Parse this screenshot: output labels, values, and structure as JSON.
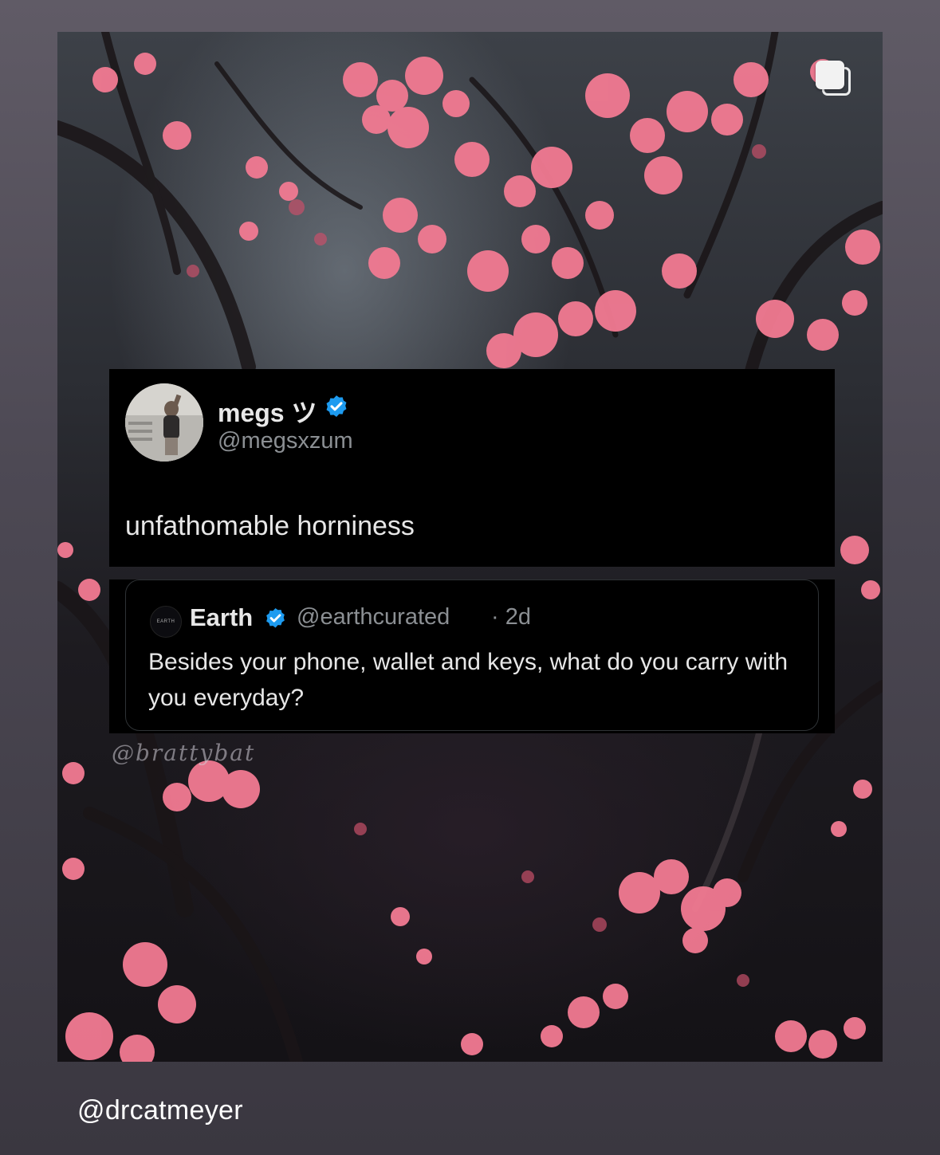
{
  "post": {
    "multiple_images_icon": "carousel-icon",
    "watermark": "@brattybat",
    "tweet": {
      "display_name": "megs ツ",
      "handle": "@megsxzum",
      "verified_icon": "verified-badge-icon",
      "text": "unfathomable horniness"
    },
    "quoted_tweet": {
      "avatar_label": "EARTH",
      "display_name": "Earth",
      "verified_icon": "verified-badge-icon",
      "handle": "@earthcurated",
      "time": "· 2d",
      "text": "Besides your phone, wallet and keys, what do you carry with you everyday?"
    }
  },
  "caption": "@drcatmeyer",
  "colors": {
    "verified_blue": "#1d9bf0",
    "blossom_pink": "#f07890",
    "tweet_background": "#000000"
  }
}
